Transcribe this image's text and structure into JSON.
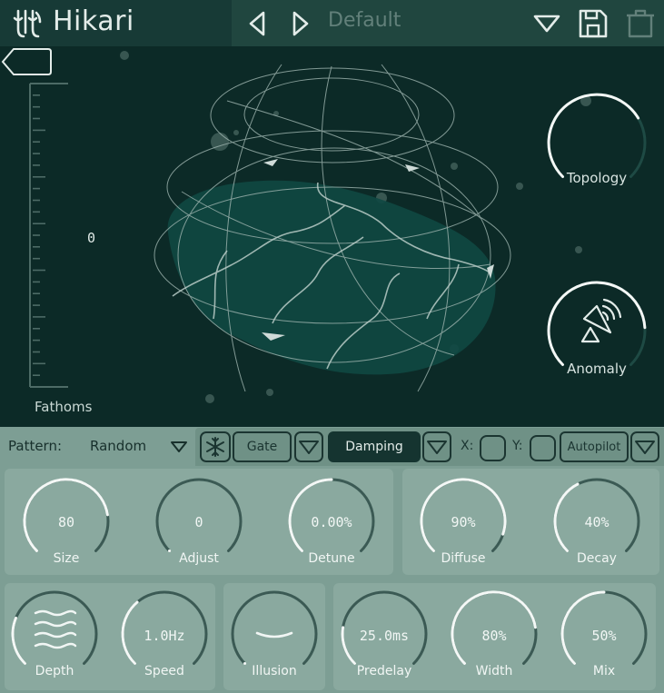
{
  "app": {
    "title": "Hikari"
  },
  "preset": {
    "name": "Default"
  },
  "visualizer": {
    "fathoms_label": "Fathoms",
    "fathoms_value": "0",
    "topology_label": "Topology",
    "anomaly_label": "Anomaly",
    "topology_level": 0.72,
    "anomaly_level": 0.82
  },
  "toolbar": {
    "pattern_label": "Pattern:",
    "pattern_value": "Random",
    "gate_label": "Gate",
    "damping_label": "Damping",
    "x_label": "X:",
    "y_label": "Y:",
    "autopilot_label": "Autopilot"
  },
  "knobs": {
    "size": {
      "label": "Size",
      "value": "80",
      "level": 0.8
    },
    "adjust": {
      "label": "Adjust",
      "value": "0",
      "level": 0.0
    },
    "detune": {
      "label": "Detune",
      "value": "0.00%",
      "level": 0.5
    },
    "diffuse": {
      "label": "Diffuse",
      "value": "90%",
      "level": 0.9
    },
    "decay": {
      "label": "Decay",
      "value": "40%",
      "level": 0.4
    },
    "depth": {
      "label": "Depth",
      "level": 0.25
    },
    "speed": {
      "label": "Speed",
      "value": "1.0Hz",
      "level": 0.35
    },
    "illusion": {
      "label": "Illusion",
      "level": 0.0
    },
    "predelay": {
      "label": "Predelay",
      "value": "25.0ms",
      "level": 0.2
    },
    "width": {
      "label": "Width",
      "value": "80%",
      "level": 0.8
    },
    "mix": {
      "label": "Mix",
      "value": "50%",
      "level": 0.5
    }
  },
  "colors": {
    "background": "#0c2a27",
    "header": "#173a36",
    "controls": "#7d9e94",
    "panel": "#8aa99f",
    "knob_track": "#3b5a54",
    "knob_fill": "#f4f8f6"
  }
}
